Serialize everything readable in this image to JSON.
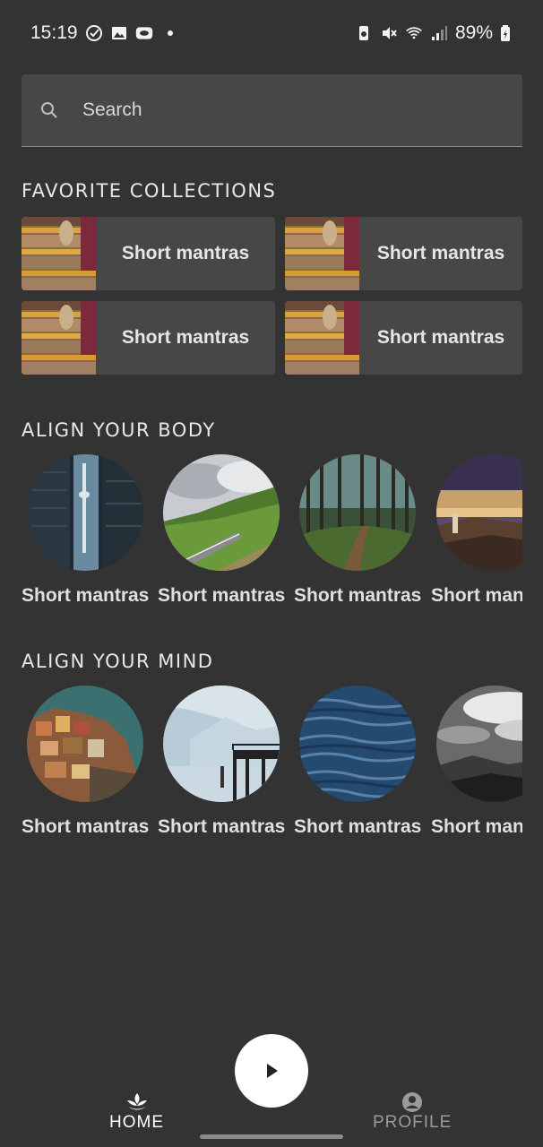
{
  "status_bar": {
    "time": "15:19",
    "battery": "89%"
  },
  "search": {
    "placeholder": "Search"
  },
  "sections": {
    "favorites_title": "FAVORITE COLLECTIONS",
    "body_title": "ALIGN YOUR BODY",
    "mind_title": "ALIGN YOUR MIND"
  },
  "favorites": [
    {
      "label": "Short mantras"
    },
    {
      "label": "Short mantras"
    },
    {
      "label": "Short mantras"
    },
    {
      "label": "Short mantras"
    }
  ],
  "body_items": [
    {
      "label": "Short mantras",
      "image": "city-tower"
    },
    {
      "label": "Short mantras",
      "image": "mountain-road"
    },
    {
      "label": "Short mantras",
      "image": "forest-path"
    },
    {
      "label": "Short man",
      "image": "sunset-hills"
    }
  ],
  "mind_items": [
    {
      "label": "Short mantras",
      "image": "coastal-village"
    },
    {
      "label": "Short mantras",
      "image": "pier-fog"
    },
    {
      "label": "Short mantras",
      "image": "ocean-waves"
    },
    {
      "label": "Short man",
      "image": "cloudy-mountains"
    }
  ],
  "nav": {
    "home_label": "HOME",
    "profile_label": "PROFILE"
  },
  "colors": {
    "background": "#333333",
    "card": "#474747",
    "accent": "#ffffff"
  }
}
